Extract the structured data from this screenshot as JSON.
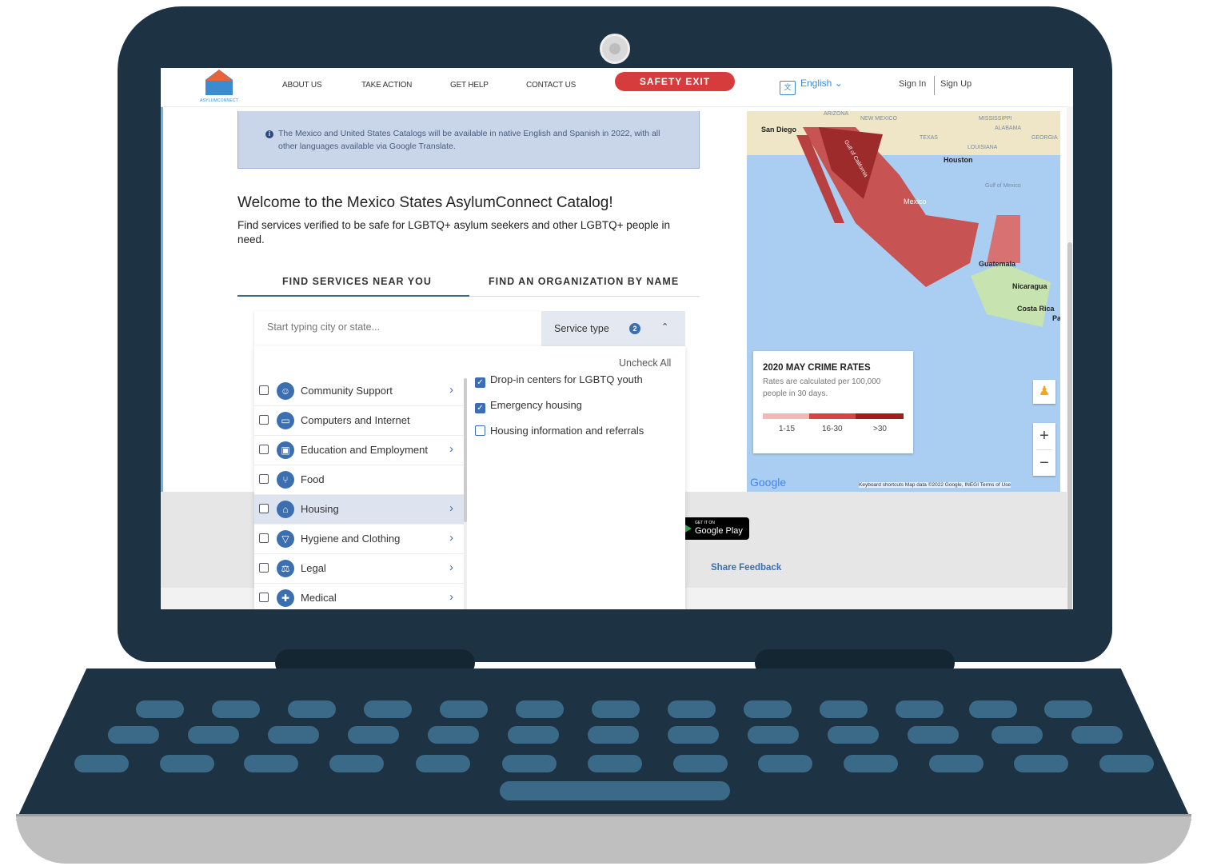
{
  "nav": {
    "logo_text": "ASYLUMCONNECT",
    "links": [
      "ABOUT US",
      "TAKE ACTION",
      "GET HELP",
      "CONTACT US"
    ],
    "safety_exit": "SAFETY EXIT",
    "language": "English",
    "sign_in": "Sign In",
    "sign_up": "Sign Up"
  },
  "notice": {
    "icon": "info-icon",
    "text": "The Mexico and United States Catalogs will be available in native English and Spanish in 2022, with all other languages available via Google Translate."
  },
  "welcome": {
    "title": "Welcome to the Mexico States AsylumConnect Catalog!",
    "subtitle": "Find services verified to be safe for LGBTQ+ asylum seekers and other LGBTQ+ people in need."
  },
  "tabs": [
    "FIND SERVICES NEAR YOU",
    "FIND AN ORGANIZATION BY NAME"
  ],
  "search": {
    "placeholder": "Start typing city or state...",
    "service_type_label": "Service type",
    "selected_count": "2"
  },
  "panel": {
    "uncheck_all": "Uncheck All",
    "categories": [
      {
        "label": "Community Support",
        "icon": "people-icon",
        "has_arrow": true
      },
      {
        "label": "Computers and Internet",
        "icon": "computer-icon",
        "has_arrow": false
      },
      {
        "label": "Education and Employment",
        "icon": "briefcase-icon",
        "has_arrow": true
      },
      {
        "label": "Food",
        "icon": "utensils-icon",
        "has_arrow": false
      },
      {
        "label": "Housing",
        "icon": "house-icon",
        "has_arrow": true,
        "selected": true
      },
      {
        "label": "Hygiene and Clothing",
        "icon": "shirt-icon",
        "has_arrow": true
      },
      {
        "label": "Legal",
        "icon": "gavel-icon",
        "has_arrow": true
      },
      {
        "label": "Medical",
        "icon": "medical-icon",
        "has_arrow": true
      }
    ],
    "subcategories": [
      {
        "label": "Drop-in centers for LGBTQ youth",
        "checked": true
      },
      {
        "label": "Emergency housing",
        "checked": true
      },
      {
        "label": "Housing information and referrals",
        "checked": false
      }
    ]
  },
  "map": {
    "labels": [
      "San Diego",
      "Houston",
      "Guatemala",
      "Nicaragua",
      "Costa Rica",
      "Pa",
      "Mexico",
      "Gulf of Mexico",
      "ARIZONA",
      "NEW MEXICO",
      "TEXAS",
      "LOUISIANA",
      "MISSISSIPPI",
      "ALABAMA",
      "GEORGIA",
      "Gulf of California"
    ],
    "legend_title": "2020 MAY CRIME RATES",
    "legend_desc": "Rates are calculated per 100,000 people in 30 days.",
    "legend_bins": [
      "1-15",
      "16-30",
      ">30"
    ],
    "legend_colors": [
      "#f2b8b8",
      "#d64545",
      "#a01e1e"
    ],
    "attribution": "Keyboard shortcuts   Map data ©2022 Google, INEGI   Terms of Use",
    "google": "Google"
  },
  "footer": {
    "google_play_small": "GET IT ON",
    "google_play_big": "Google Play",
    "share_feedback": "Share Feedback"
  }
}
